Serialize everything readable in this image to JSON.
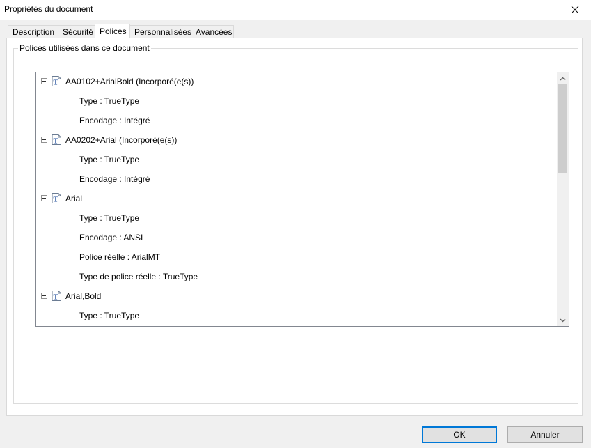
{
  "window": {
    "title": "Propriétés du document",
    "close_icon": "close-icon"
  },
  "tabs": [
    {
      "label": "Description",
      "active": false
    },
    {
      "label": "Sécurité",
      "active": false
    },
    {
      "label": "Polices",
      "active": true
    },
    {
      "label": "Personnalisées",
      "active": false
    },
    {
      "label": "Avancées",
      "active": false
    }
  ],
  "fonts_group": {
    "label": "Polices utilisées dans ce document",
    "fonts": [
      {
        "name": "AA0102+ArialBold (Incorporé(e(s))",
        "icon": "truetype-font-icon",
        "expanded": true,
        "properties": [
          "Type : TrueType",
          "Encodage : Intégré"
        ]
      },
      {
        "name": "AA0202+Arial (Incorporé(e(s))",
        "icon": "truetype-font-icon",
        "expanded": true,
        "properties": [
          "Type : TrueType",
          "Encodage : Intégré"
        ]
      },
      {
        "name": "Arial",
        "icon": "truetype-font-icon",
        "expanded": true,
        "properties": [
          "Type : TrueType",
          "Encodage : ANSI",
          "Police réelle : ArialMT",
          "Type de police réelle : TrueType"
        ]
      },
      {
        "name": "Arial,Bold",
        "icon": "truetype-font-icon",
        "expanded": true,
        "properties": [
          "Type : TrueType"
        ]
      }
    ]
  },
  "buttons": {
    "ok": "OK",
    "cancel": "Annuler"
  },
  "colors": {
    "focus_border": "#0078d7",
    "font_icon_blue": "#1f4e9c"
  }
}
